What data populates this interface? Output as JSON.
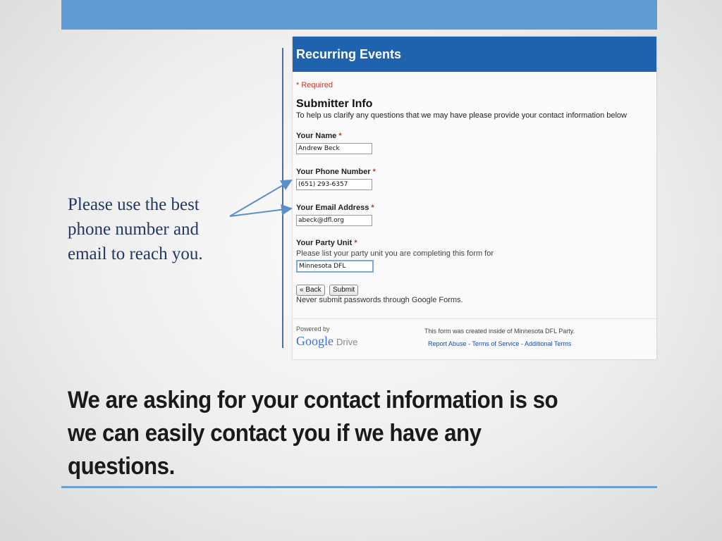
{
  "slide": {
    "callout": "Please use the best phone number and email to reach you.",
    "headline": "We are asking for your contact information is so we can easily contact you if we have any questions."
  },
  "form": {
    "title": "Recurring Events",
    "required_note": "* Required",
    "section_title": "Submitter Info",
    "section_desc": "To help us clarify any questions that we may have please provide your contact information below",
    "fields": {
      "name": {
        "label": "Your Name",
        "value": "Andrew Beck"
      },
      "phone": {
        "label": "Your Phone Number",
        "value": "(651) 293-6357"
      },
      "email": {
        "label": "Your Email Address",
        "value": "abeck@dfl.org"
      },
      "party": {
        "label": "Your Party Unit",
        "help": "Please list your party unit you are completing this form for",
        "value": "Minnesota DFL"
      }
    },
    "required_star": "*",
    "back_label": "« Back",
    "submit_label": "Submit",
    "warning": "Never submit passwords through Google Forms.",
    "footer": {
      "powered_by": "Powered by",
      "logo_text": "Google",
      "drive_text": "Drive",
      "created_note": "This form was created inside of Minnesota DFL Party.",
      "links": [
        "Report Abuse",
        "Terms of Service",
        "Additional Terms"
      ],
      "link_sep": "-"
    }
  },
  "colors": {
    "accent_bar": "#5e9cd3",
    "form_header": "#1f62ad",
    "required": "#c0392b",
    "callout_text": "#1f3864"
  }
}
